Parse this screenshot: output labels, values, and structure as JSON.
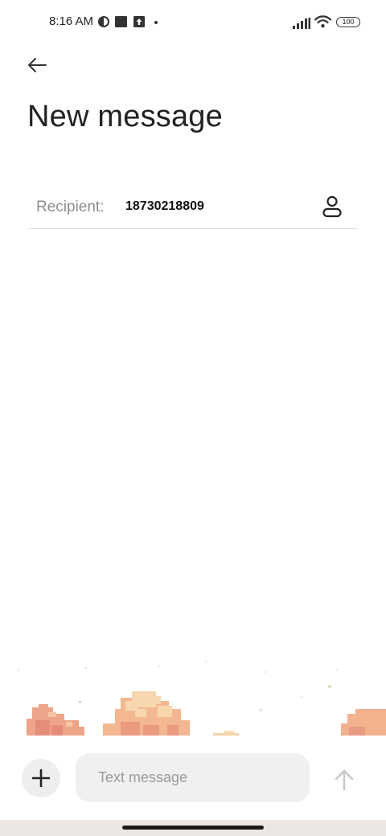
{
  "status_bar": {
    "time": "8:16 AM",
    "battery": "100",
    "icons": [
      "app-icon-circle",
      "app-icon-square",
      "app-icon-upload",
      "notification-dot",
      "signal-icon",
      "wifi-icon",
      "battery-icon"
    ]
  },
  "header": {
    "back_icon": "back-arrow-icon",
    "title": "New message"
  },
  "recipient": {
    "label": "Recipient:",
    "value": "18730218809",
    "contact_icon": "contact-person-icon"
  },
  "composer": {
    "add_icon": "plus-icon",
    "placeholder": "Text message",
    "send_icon": "send-arrow-up-icon"
  },
  "colors": {
    "background": "#ffffff",
    "input_bg": "#f0f0f0",
    "label_gray": "#8e8e8e",
    "cloud_peach": "#f2b38e",
    "cloud_light": "#f7d3aa"
  }
}
